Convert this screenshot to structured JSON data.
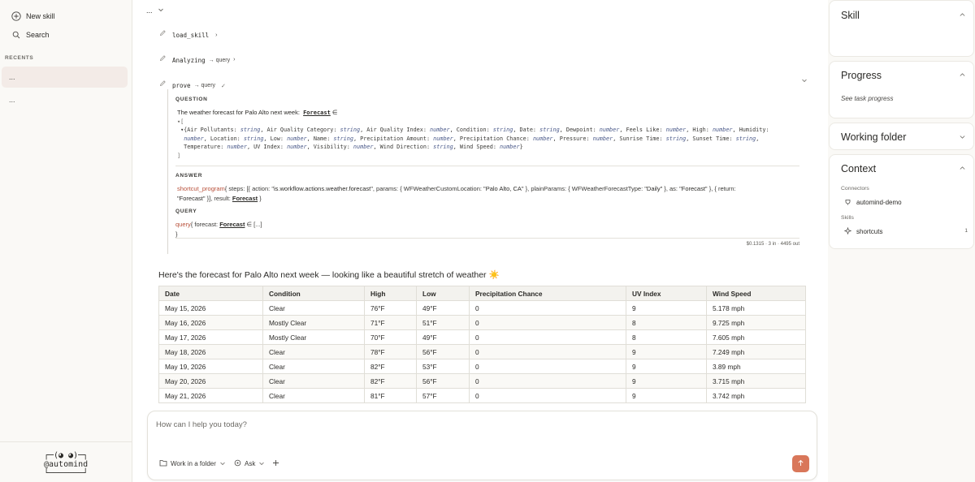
{
  "sidebar": {
    "new_skill": "New skill",
    "search": "Search",
    "recents_label": "RECENTS",
    "recents": [
      "...",
      "..."
    ],
    "logo_lines": [
      "┌─(◕ ◕)─┐",
      "@automind",
      "└───────┘"
    ]
  },
  "main": {
    "top_item": "...",
    "steps": [
      {
        "name": "load_skill",
        "sub": "",
        "arrow": "›"
      },
      {
        "name": "Analyzing",
        "sub": "→ query",
        "arrow": "›"
      },
      {
        "name": "prove",
        "sub": "→ query",
        "arrow": "✓"
      }
    ],
    "question_label": "QUESTION",
    "question_text": "The weather forecast for Palo Alto next week:",
    "question_type": "Forecast",
    "question_elem": "∈",
    "type_lines": [
      "▾[",
      "  ▾{Air Pollutants: string, Air Quality Category: string, Air Quality Index: number, Condition: string, Date: string, Dewpoint: number, Feels Like: number, High: number, Humidity:",
      "   number, Location: string, Low: number, Name: string, Precipitation Amount: number, Precipitation Chance: number, Pressure: number, Sunrise Time: string, Sunset Time: string,",
      "   Temperature: number, UV Index: number, Visibility: number, Wind Direction: string, Wind Speed: number}",
      " ]"
    ],
    "answer_label": "ANSWER",
    "answer_line1": {
      "fn": "shortcut_program",
      "text1": "{ steps: [{ action: ",
      "action": "\"is.workflow.actions.weather.forecast\"",
      "text2": ", params: { WFWeatherCustomLocation: ",
      "loc": "\"Palo Alto, CA\"",
      "text3": " }, plainParams: { WFWeatherForecastType: ",
      "ftype": "\"Daily\"",
      "text4": " }, as: ",
      "as": "\"Forecast\"",
      "text5": " }, { return:"
    },
    "answer_line2": {
      "ret": "\"Forecast\"",
      "text": " }], result: ",
      "result": "Forecast",
      "end": " }"
    },
    "query_label": "QUERY",
    "query_fn": "query",
    "query_text": "{ forecast: ",
    "query_type": "Forecast",
    "query_rest": " ∈ [...]",
    "query_close": "}",
    "cost": "$0.1315 · 3 in · 4495 out",
    "reply": "Here's the forecast for Palo Alto next week — looking like a beautiful stretch of weather ☀️",
    "table": {
      "headers": [
        "Date",
        "Condition",
        "High",
        "Low",
        "Precipitation Chance",
        "UV Index",
        "Wind Speed"
      ],
      "rows": [
        [
          "May 15, 2026",
          "Clear",
          "76°F",
          "49°F",
          "0",
          "9",
          "5.178 mph"
        ],
        [
          "May 16, 2026",
          "Mostly Clear",
          "71°F",
          "51°F",
          "0",
          "8",
          "9.725 mph"
        ],
        [
          "May 17, 2026",
          "Mostly Clear",
          "70°F",
          "49°F",
          "0",
          "8",
          "7.605 mph"
        ],
        [
          "May 18, 2026",
          "Clear",
          "78°F",
          "56°F",
          "0",
          "9",
          "7.249 mph"
        ],
        [
          "May 19, 2026",
          "Clear",
          "82°F",
          "53°F",
          "0",
          "9",
          "3.89 mph"
        ],
        [
          "May 20, 2026",
          "Clear",
          "82°F",
          "56°F",
          "0",
          "9",
          "3.715 mph"
        ],
        [
          "May 21, 2026",
          "Clear",
          "81°F",
          "57°F",
          "0",
          "9",
          "3.742 mph"
        ]
      ]
    },
    "composer": {
      "placeholder": "How can I help you today?",
      "folder_btn": "Work in a folder",
      "mode_btn": "Ask"
    }
  },
  "right": {
    "skill": "Skill",
    "progress": "Progress",
    "progress_hint": "See task progress",
    "working_folder": "Working folder",
    "context": "Context",
    "connectors_label": "Connectors",
    "connector": "automind-demo",
    "skills_label": "Skills",
    "skill_item": "shortcuts",
    "skill_count": "1"
  },
  "colors": {
    "accent": "#d9775a",
    "active_row": "#f3ebe7",
    "type_italic": "#4b5a8a",
    "fn_color": "#b8503a"
  }
}
